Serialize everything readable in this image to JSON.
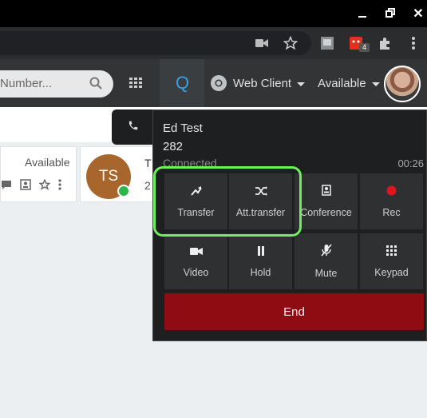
{
  "header": {
    "search_placeholder": "Number...",
    "q_label": "Q",
    "client_label": "Web Client",
    "status_label": "Available"
  },
  "browser": {
    "extension_badge": "4"
  },
  "contacts": {
    "card1": {
      "status": "Available"
    },
    "card2": {
      "initials": "TS",
      "name_partial": "T",
      "ext_partial": "2"
    }
  },
  "call": {
    "name": "Ed Test",
    "extension": "282",
    "state": "Connected",
    "timer": "00:26",
    "buttons": [
      {
        "label": "Transfer",
        "icon": "transfer-icon"
      },
      {
        "label": "Att.transfer",
        "icon": "shuffle-icon"
      },
      {
        "label": "Conference",
        "icon": "conference-icon"
      },
      {
        "label": "Rec",
        "icon": "record-icon"
      },
      {
        "label": "Video",
        "icon": "video-icon"
      },
      {
        "label": "Hold",
        "icon": "pause-icon"
      },
      {
        "label": "Mute",
        "icon": "mic-off-icon"
      },
      {
        "label": "Keypad",
        "icon": "keypad-icon"
      }
    ],
    "end_label": "End"
  },
  "colors": {
    "accent_blue": "#39a0e0",
    "end_red": "#8f0c12",
    "highlight_green": "#6df05a",
    "online_green": "#2bb84a",
    "record_red": "#e0141b"
  }
}
